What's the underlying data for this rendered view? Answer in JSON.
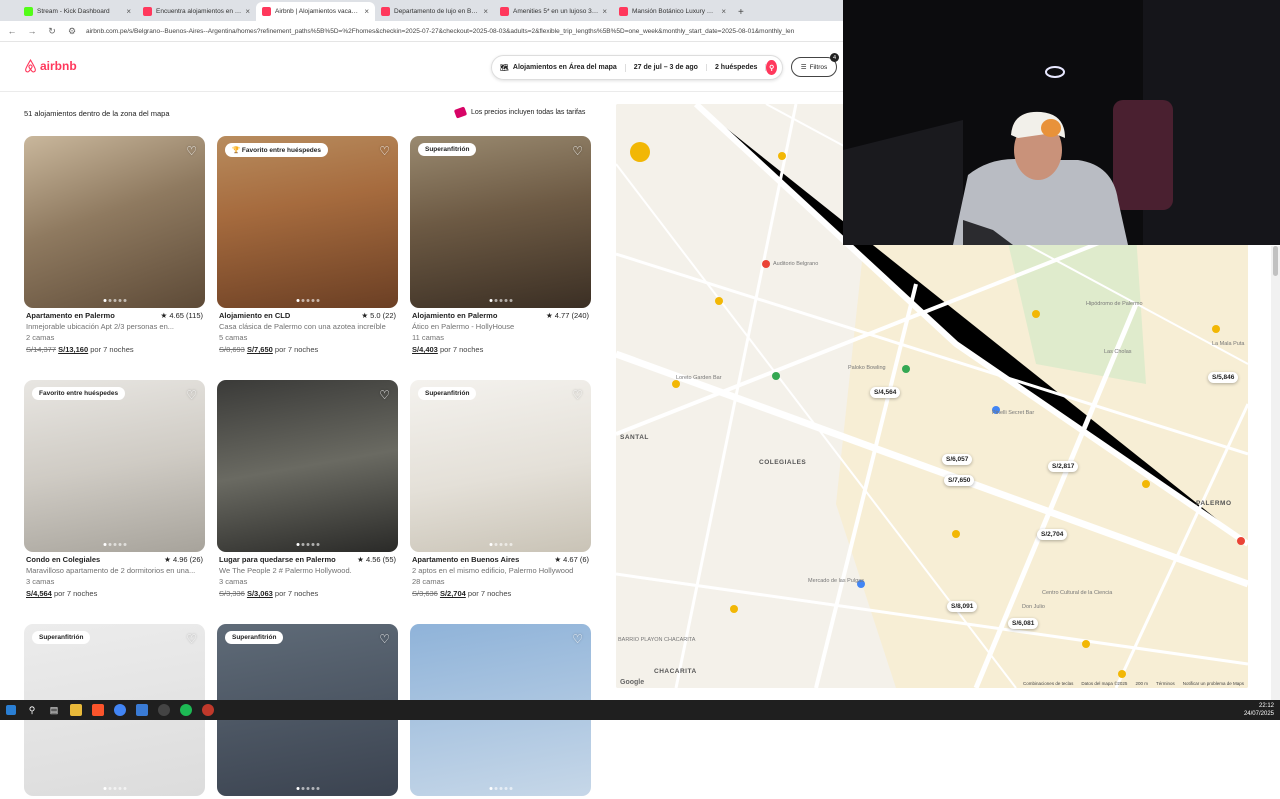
{
  "browser": {
    "tabs": [
      {
        "title": "Stream - Kick Dashboard",
        "color": "#53fc18",
        "active": false
      },
      {
        "title": "Encuentra alojamientos en Lima",
        "color": "#ff385c",
        "active": false
      },
      {
        "title": "Airbnb | Alojamientos vacacion",
        "color": "#ff385c",
        "active": true
      },
      {
        "title": "Departamento de lujo en Bosq",
        "color": "#ff385c",
        "active": false
      },
      {
        "title": "Amenities 5* en un lujoso 3 am",
        "color": "#ff385c",
        "active": false
      },
      {
        "title": "Mansión Botánico Luxury Buen",
        "color": "#ff385c",
        "active": false
      }
    ],
    "new_tab": "+",
    "url": "airbnb.com.pe/s/Belgrano--Buenos-Aires--Argentina/homes?refinement_paths%5B%5D=%2Fhomes&checkin=2025-07-27&checkout=2025-08-03&adults=2&flexible_trip_lengths%5B%5D=one_week&monthly_start_date=2025-08-01&monthly_len"
  },
  "header": {
    "logo": "airbnb",
    "search": {
      "location": "Alojamientos en Área del mapa",
      "dates": "27 de jul – 3 de ago",
      "guests": "2 huéspedes"
    },
    "filters_label": "Filtros",
    "filters_count": "4"
  },
  "results": {
    "count_text": "51 alojamientos dentro de la zona del mapa",
    "price_note": "Los precios incluyen todas las tarifas"
  },
  "listings": [
    {
      "badge": "",
      "title": "Apartamento en Palermo",
      "rating": "★ 4.65 (115)",
      "desc": "Inmejorable ubicación Apt 2/3 personas en...",
      "beds": "2 camas",
      "old_price": "S/14,377",
      "price": "S/13,160",
      "per": "por 7 noches"
    },
    {
      "badge": "🏆 Favorito entre huéspedes",
      "title": "Alojamiento en CLD",
      "rating": "★ 5.0 (22)",
      "desc": "Casa clásica de Palermo con una azotea increíble",
      "beds": "5 camas",
      "old_price": "S/8,693",
      "price": "S/7,650",
      "per": "por 7 noches"
    },
    {
      "badge": "Superanfitrión",
      "title": "Alojamiento en Palermo",
      "rating": "★ 4.77 (240)",
      "desc": "Ático en Palermo - HollyHouse",
      "beds": "11 camas",
      "old_price": "",
      "price": "S/4,403",
      "per": "por 7 noches"
    },
    {
      "badge": "Favorito entre huéspedes",
      "title": "Condo en Colegiales",
      "rating": "★ 4.96 (26)",
      "desc": "Maravilloso apartamento de 2 dormitorios en una...",
      "beds": "3 camas",
      "old_price": "",
      "price": "S/4,564",
      "per": "por 7 noches"
    },
    {
      "badge": "",
      "title": "Lugar para quedarse en Palermo",
      "rating": "★ 4.56 (55)",
      "desc": "We The People 2 # Palermo Hollywood.",
      "beds": "3 camas",
      "old_price": "S/3,336",
      "price": "S/3,063",
      "per": "por 7 noches"
    },
    {
      "badge": "Superanfitrión",
      "title": "Apartamento en Buenos Aires",
      "rating": "★ 4.67 (6)",
      "desc": "2 aptos en el mismo edificio, Palermo Hollywood",
      "beds": "28 camas",
      "old_price": "S/3,636",
      "price": "S/2,704",
      "per": "por 7 noches"
    },
    {
      "badge": "Superanfitrión",
      "title": "",
      "rating": "",
      "desc": "",
      "beds": "",
      "old_price": "",
      "price": "",
      "per": ""
    },
    {
      "badge": "Superanfitrión",
      "title": "",
      "rating": "",
      "desc": "",
      "beds": "",
      "old_price": "",
      "price": "",
      "per": ""
    },
    {
      "badge": "",
      "title": "",
      "rating": "",
      "desc": "",
      "beds": "",
      "old_price": "",
      "price": "",
      "per": ""
    }
  ],
  "map": {
    "prices": [
      "S/4,564",
      "S/5,846",
      "S/6,057",
      "S/2,817",
      "S/7,650",
      "S/2,704",
      "S/8,091",
      "S/6,081"
    ],
    "areas": [
      "COLEGIALES",
      "PALERMO",
      "CHACARITA",
      "SANTAL",
      "BARRIO PLAYON CHACARITA"
    ],
    "places": [
      "Auditorio Belgrano",
      "Paloko Bowling",
      "Loreto Garden Bar",
      "Mercado de las Pulgas",
      "Hipódromo de Palermo",
      "Las Cholas",
      "La Mala Puta",
      "Pinelli Secret Bar",
      "Mercado de Pulgas",
      "Don Julio",
      "Centro Cultural de la Ciencia"
    ],
    "footer": [
      "Combinaciones de teclas",
      "Datos del mapa ©2025",
      "200 m",
      "Términos",
      "Notificar un problema de Maps"
    ],
    "google": "Google"
  },
  "taskbar": {
    "time": "22:12",
    "date": "24/07/2025"
  }
}
